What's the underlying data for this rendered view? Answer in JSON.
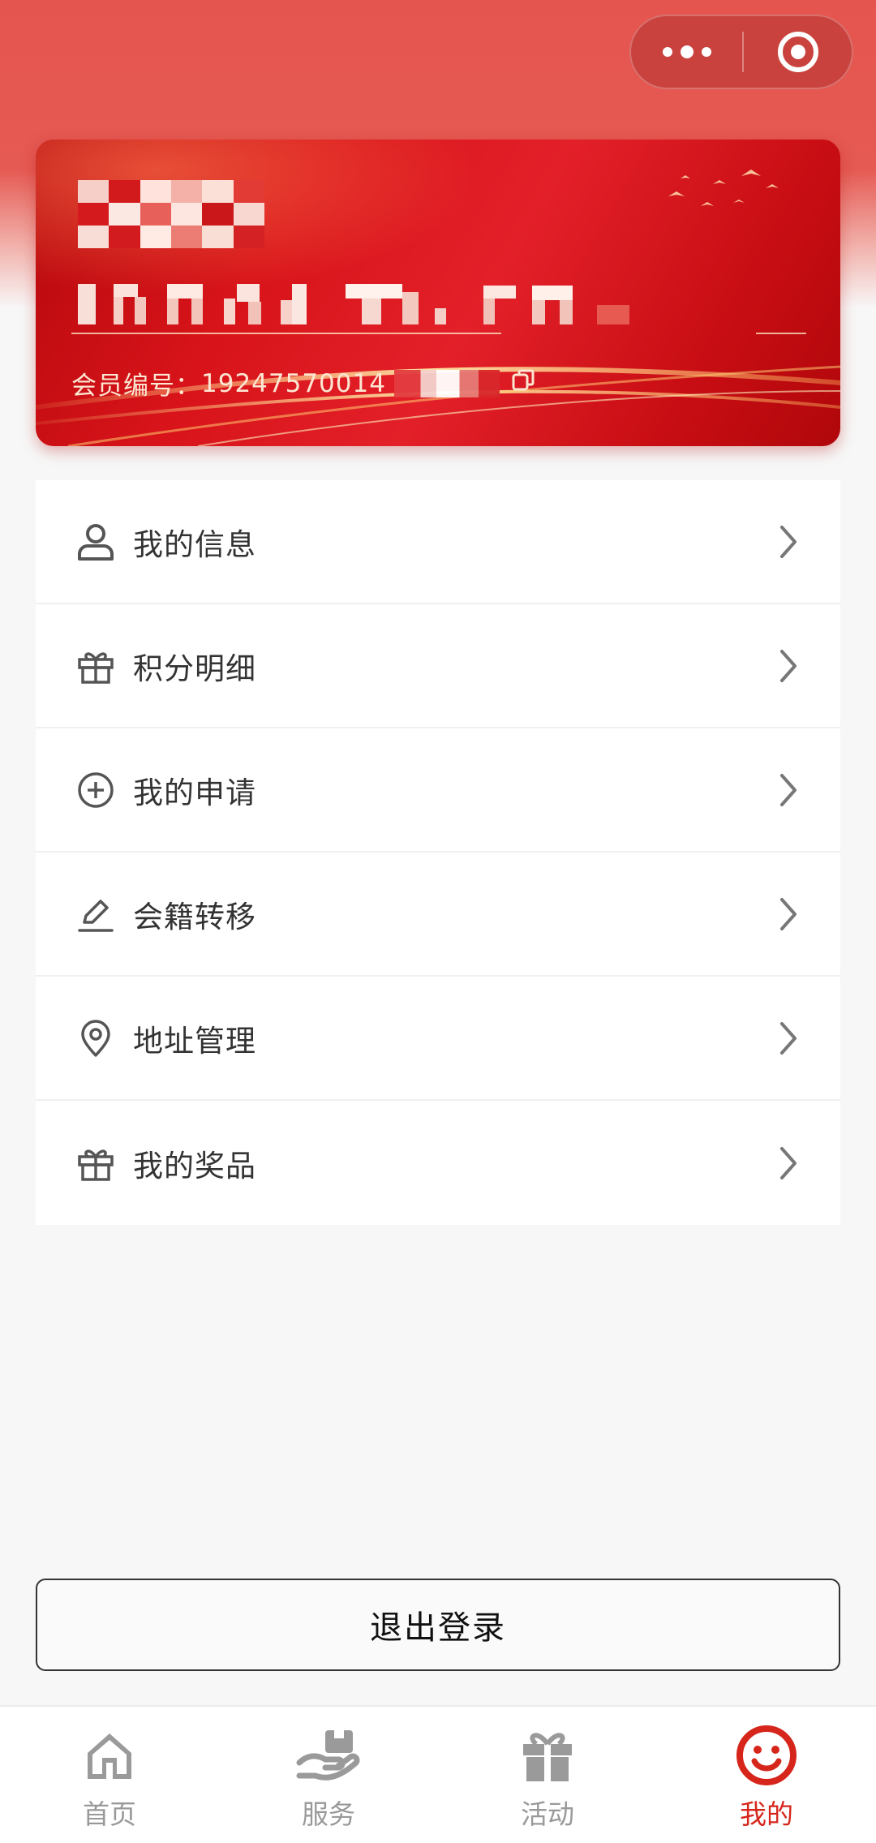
{
  "header": {
    "more_icon": "more-dots-icon",
    "close_icon": "target-circle-icon"
  },
  "card": {
    "member_label": "会员编号：",
    "member_number": "19247570014",
    "copy_icon": "copy-icon"
  },
  "menu": {
    "items": [
      {
        "label": "我的信息",
        "icon": "user-icon"
      },
      {
        "label": "积分明细",
        "icon": "gift-icon"
      },
      {
        "label": "我的申请",
        "icon": "plus-circle-icon"
      },
      {
        "label": "会籍转移",
        "icon": "edit-pencil-icon"
      },
      {
        "label": "地址管理",
        "icon": "location-pin-icon"
      },
      {
        "label": "我的奖品",
        "icon": "gift-icon"
      }
    ]
  },
  "logout": {
    "label": "退出登录"
  },
  "tabbar": {
    "tabs": [
      {
        "label": "首页",
        "icon": "home-icon",
        "active": false
      },
      {
        "label": "服务",
        "icon": "hand-box-icon",
        "active": false
      },
      {
        "label": "活动",
        "icon": "gift-box-icon",
        "active": false
      },
      {
        "label": "我的",
        "icon": "smile-face-icon",
        "active": true
      }
    ]
  },
  "colors": {
    "accent": "#d6261c",
    "header_red": "#e5554f",
    "card_red": "#d8141a",
    "text": "#333333",
    "inactive": "#999999"
  }
}
